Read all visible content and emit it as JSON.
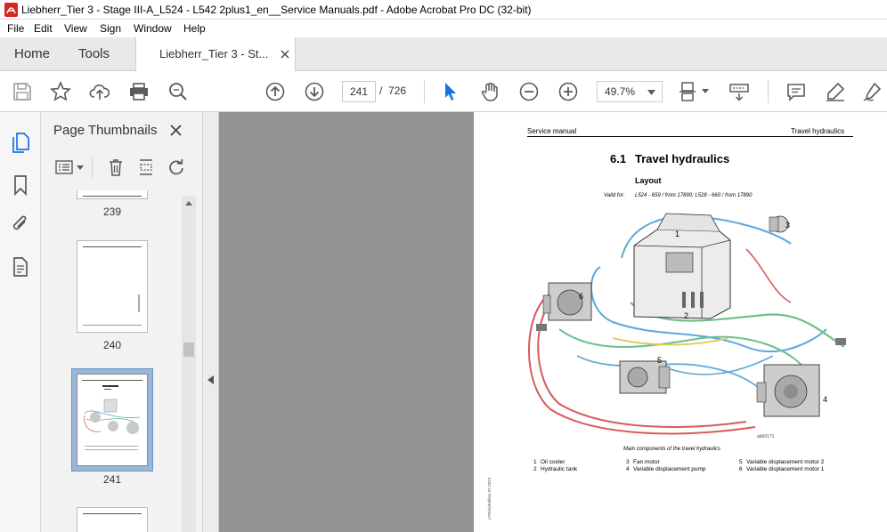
{
  "window": {
    "title": "Liebherr_Tier 3 - Stage III-A_L524 - L542 2plus1_en__Service Manuals.pdf - Adobe Acrobat Pro DC (32-bit)"
  },
  "menu": [
    "File",
    "Edit",
    "View",
    "Sign",
    "Window",
    "Help"
  ],
  "tabs": {
    "home": "Home",
    "tools": "Tools",
    "document": "Liebherr_Tier 3 - St..."
  },
  "toolbar": {
    "current_page": "241",
    "page_separator": "/",
    "total_pages": "726",
    "zoom": "49.7%"
  },
  "panel": {
    "title": "Page Thumbnails",
    "thumbnails": [
      {
        "label": "239"
      },
      {
        "label": "240"
      },
      {
        "label": "241"
      }
    ]
  },
  "page": {
    "header_left": "Service manual",
    "header_right": "Travel hydraulics",
    "section_number": "6.1",
    "section_title": "Travel hydraulics",
    "subheading": "Layout",
    "valid_for_label": "Valid for:",
    "valid_for_value": "L524 - 659 / from 17890;  L528 - 660 / from 17890",
    "figure_caption": "Main components of the travel hydraulics",
    "image_ref": "ab00171",
    "callouts": [
      "1",
      "2",
      "3",
      "4",
      "5",
      "6"
    ],
    "legend": [
      {
        "num": "1",
        "text": "Oil cooler"
      },
      {
        "num": "2",
        "text": "Hydraulic tank"
      },
      {
        "num": "3",
        "text": "Fan motor"
      },
      {
        "num": "4",
        "text": "Variable displacement pump"
      },
      {
        "num": "5",
        "text": "Variable displacement motor 2"
      },
      {
        "num": "6",
        "text": "Variable displacement motor 1"
      }
    ],
    "side_code": "LFR/en/Edition 07.2013"
  },
  "colors": {
    "acrobat_red": "#d7261e",
    "icon_gray": "#5a5a5a",
    "hose_blue": "#5fa8d8",
    "hose_green": "#6dbf8a",
    "hose_red": "#d85a5a",
    "hose_yellow": "#e0c85a"
  }
}
